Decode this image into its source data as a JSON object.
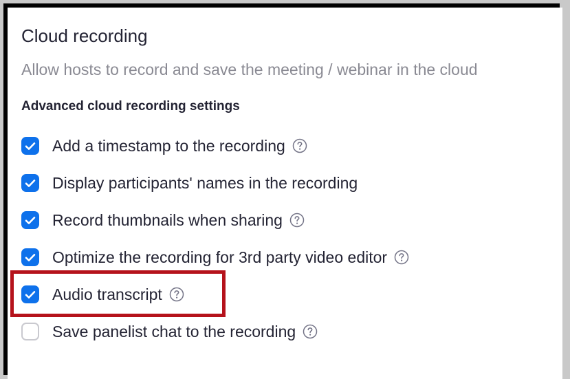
{
  "settings": {
    "title": "Cloud recording",
    "description": "Allow hosts to record and save the meeting / webinar in the cloud",
    "section_title": "Advanced cloud recording settings",
    "options": [
      {
        "label": "Add a timestamp to the recording",
        "checked": true,
        "has_help": true
      },
      {
        "label": "Display participants' names in the recording",
        "checked": true,
        "has_help": false
      },
      {
        "label": "Record thumbnails when sharing",
        "checked": true,
        "has_help": true
      },
      {
        "label": "Optimize the recording for 3rd party video editor",
        "checked": true,
        "has_help": true
      },
      {
        "label": "Audio transcript",
        "checked": true,
        "has_help": true
      },
      {
        "label": "Save panelist chat to the recording",
        "checked": false,
        "has_help": true
      }
    ]
  },
  "icons": {
    "checkmark": "checkmark-icon",
    "help": "question-circle-icon"
  },
  "colors": {
    "checkbox_checked": "#0e71eb",
    "checkbox_unchecked_border": "#c9c9cf",
    "highlight_border": "#b5121b",
    "text_primary": "#232333",
    "text_secondary": "#8a8a93"
  },
  "annotation": {
    "highlighted_option": "Audio transcript"
  }
}
